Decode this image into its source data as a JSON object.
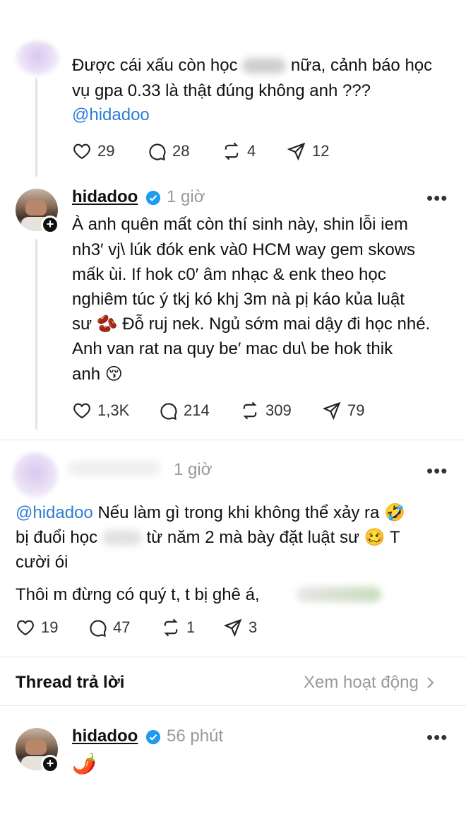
{
  "comment1": {
    "text_line1_a": "Được cái xấu còn học",
    "text_line1_b": "nữa, cảnh báo học",
    "text_line2": "vụ gpa 0.33 là thật đúng không anh ???",
    "mention": "@hidadoo",
    "likes": "29",
    "comments": "28",
    "reposts": "4",
    "shares": "12"
  },
  "reply1": {
    "username": "hidadoo",
    "time": "1 giờ",
    "lines": [
      "À anh quên mất còn thí sinh này, shin lỗi iem",
      "nh3′ vj\\ lúk đók enk và0 HCM way gem skows",
      "mấk ùi. If hok c0′ âm nhạc & enk theo học",
      "nghiêm túc ý tkj kó khj 3m nà pị káo kủa luật",
      "sư 🫘 Đỗ ruj nek. Ngủ sớm mai dậy đi học nhé.",
      "Anh van rat na quy be′ mac du\\ be hok thik",
      "anh 😚"
    ],
    "likes": "1,3K",
    "comments": "214",
    "reposts": "309",
    "shares": "79"
  },
  "comment2": {
    "time": "1 giờ",
    "mention": "@hidadoo",
    "line1_rest": "Nếu làm gì trong khi không thể xảy ra 🤣",
    "line2_a": "bị đuổi học",
    "line2_b": "từ năm 2 mà bày đặt luật sư 🥴 T",
    "line3": "cười ói",
    "line4": "Thôi m đừng có quý t, t bị ghê á,",
    "likes": "19",
    "comments": "47",
    "reposts": "1",
    "shares": "3"
  },
  "thread_header": {
    "title": "Thread trả lời",
    "activity": "Xem hoạt động"
  },
  "reply2": {
    "username": "hidadoo",
    "time": "56 phút",
    "text": "🌶️"
  },
  "more_glyph": "•••",
  "colors": {
    "mention": "#2e7dd6",
    "muted": "#999999",
    "verified": "#1d9bf0"
  },
  "icons": [
    "heart-icon",
    "comment-icon",
    "repost-icon",
    "share-icon",
    "verified-icon",
    "more-icon",
    "chevron-right-icon",
    "plus-icon"
  ]
}
